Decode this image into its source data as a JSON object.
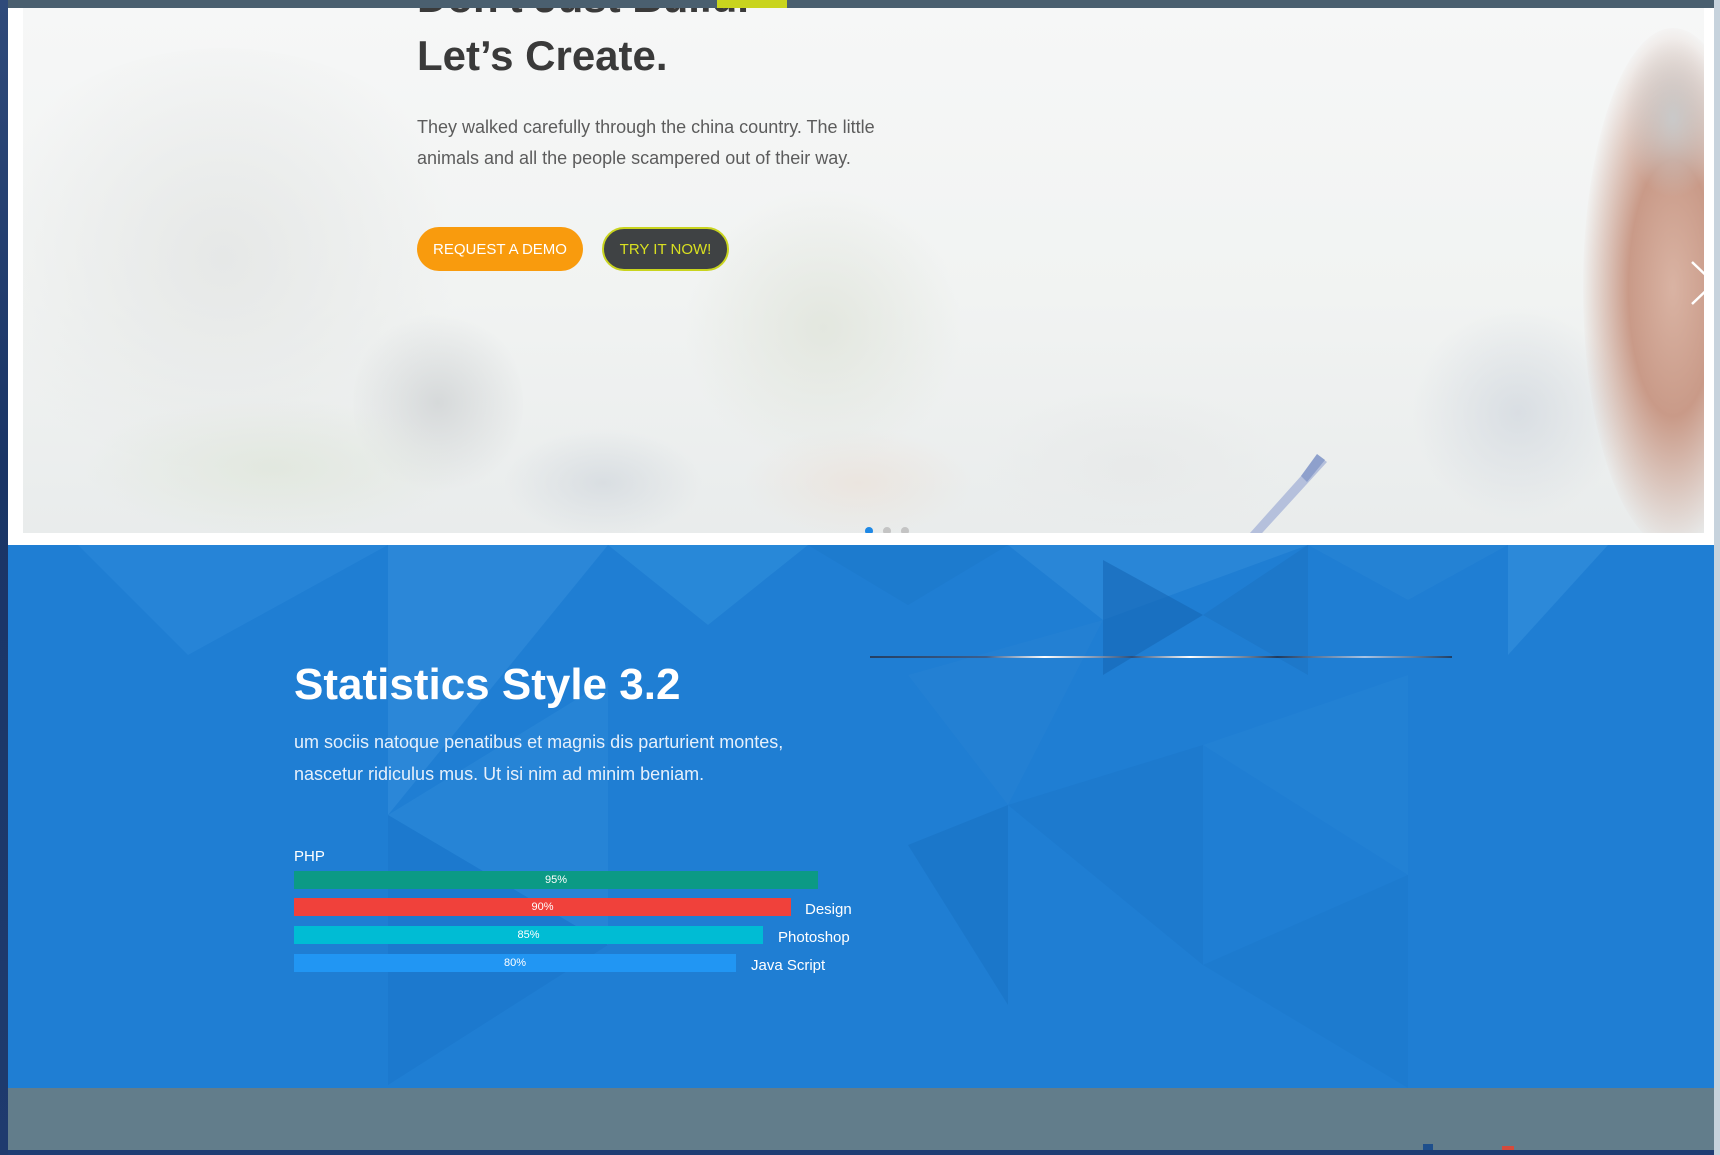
{
  "hero": {
    "heading_cut": "Don't Just Build.",
    "heading": "Let’s Create.",
    "text": "They walked carefully through the china country. The little animals and all the people scampered out of their way.",
    "demo_button": "REQUEST A DEMO",
    "try_button": "TRY IT NOW!",
    "next_icon": "chevron-right-icon",
    "dots": {
      "count": 3,
      "active_index": 0
    }
  },
  "stats": {
    "title": "Statistics Style 3.2",
    "text": "um sociis natoque penatibus et magnis dis parturient montes, nascetur ridiculus mus. Ut isi nim ad minim beniam.",
    "bars": [
      {
        "label": "PHP",
        "percent_label": "95%",
        "value": 95,
        "color": "#0b9a85"
      },
      {
        "label": "Design",
        "percent_label": "90%",
        "value": 90,
        "color": "#f0413b"
      },
      {
        "label": "Photoshop",
        "percent_label": "85%",
        "value": 85,
        "color": "#00bcd4"
      },
      {
        "label": "Java Script",
        "percent_label": "80%",
        "value": 80,
        "color": "#2196f3"
      }
    ]
  },
  "colors": {
    "accent_orange": "#f99b0d",
    "accent_lime": "#c9d41e",
    "stats_blue": "#1f7ed3",
    "footer_gray": "#627d8b"
  }
}
